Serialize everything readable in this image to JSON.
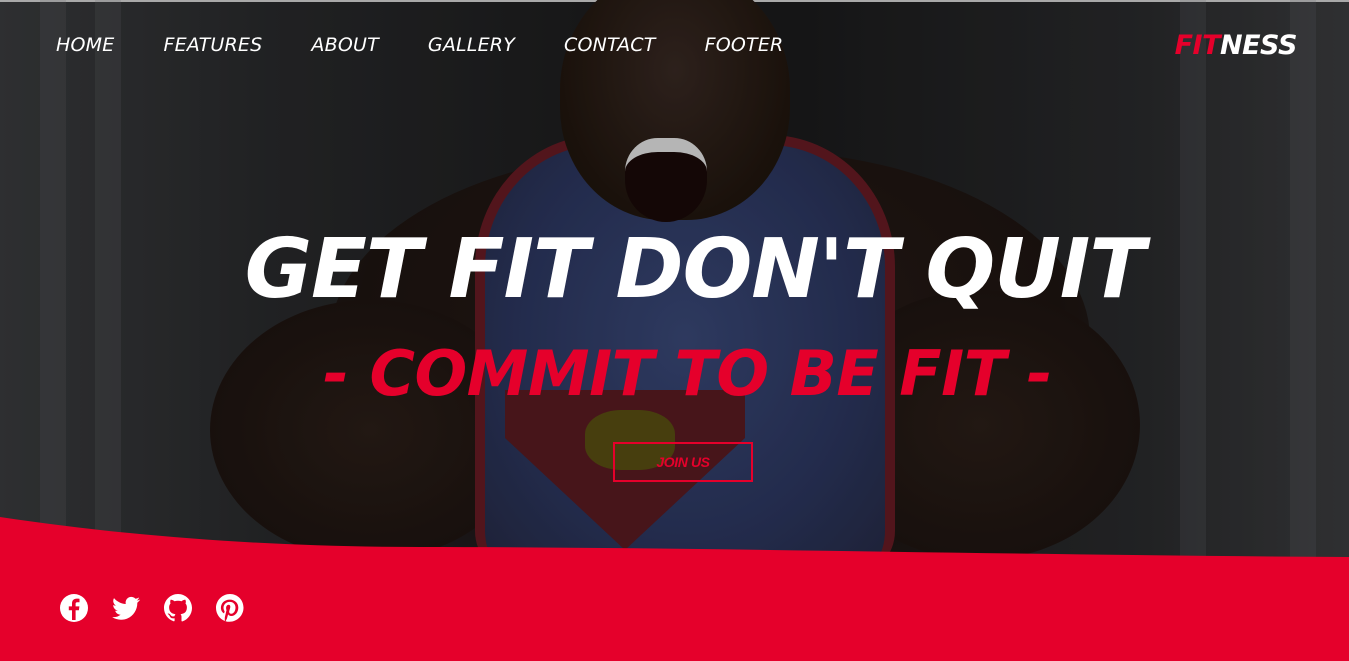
{
  "colors": {
    "accent": "#e5002b",
    "text": "#ffffff"
  },
  "nav": {
    "items": [
      {
        "label": "HOME"
      },
      {
        "label": "FEATURES"
      },
      {
        "label": "ABOUT"
      },
      {
        "label": "GALLERY"
      },
      {
        "label": "CONTACT"
      },
      {
        "label": "FOOTER"
      }
    ]
  },
  "brand": {
    "part1": "FIT",
    "part2": "NESS"
  },
  "hero": {
    "headline": "GET FIT DON'T QUIT",
    "subline": "- COMMIT TO BE FIT -",
    "cta_label": "JOIN US"
  },
  "social": {
    "icons": [
      "facebook-icon",
      "twitter-icon",
      "github-icon",
      "pinterest-icon"
    ]
  }
}
